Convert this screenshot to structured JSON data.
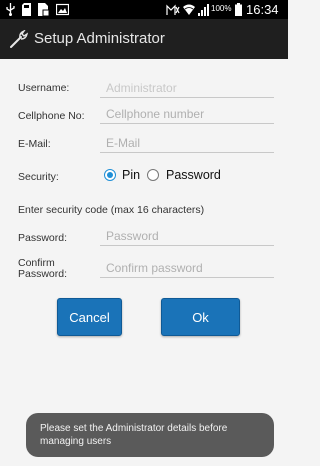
{
  "status_bar": {
    "battery_percent": "100%",
    "time": "16:34",
    "icons": [
      "usb-icon",
      "sd-card-icon",
      "file-icon",
      "image-icon",
      "signal-muted-icon",
      "wifi-icon",
      "cell-signal-icon",
      "battery-icon"
    ]
  },
  "action_bar": {
    "icon": "wrench-icon",
    "title": "Setup Administrator"
  },
  "form": {
    "username_label": "Username:",
    "username_placeholder": "Administrator",
    "cellphone_label": "Cellphone No:",
    "cellphone_placeholder": "Cellphone number",
    "email_label": "E-Mail:",
    "email_placeholder": "E-Mail",
    "security_label": "Security:",
    "security_options": [
      "Pin",
      "Password"
    ],
    "security_selected": "Pin",
    "security_code_hint": "Enter security code (max 16 characters)",
    "password_label": "Password:",
    "password_placeholder": "Password",
    "confirm_label_line1": "Confirm",
    "confirm_label_line2": "Password:",
    "confirm_placeholder": "Confirm password"
  },
  "buttons": {
    "cancel": "Cancel",
    "ok": "Ok"
  },
  "toast": {
    "line1": "Please set the Administrator details before",
    "line2": "managing users"
  },
  "colors": {
    "accent": "#1f8fd6",
    "button": "#1a73b8",
    "action_bar": "#1f1f1f",
    "toast": "#5a5a5a"
  }
}
